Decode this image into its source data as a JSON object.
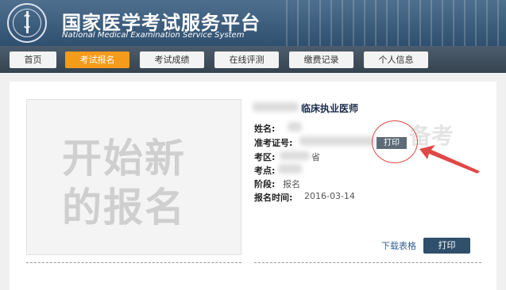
{
  "header": {
    "title_cn": "国家医学考试服务平台",
    "title_en": "National Medical Examination Service System"
  },
  "nav": {
    "items": [
      {
        "label": "首页"
      },
      {
        "label": "考试报名",
        "active": true
      },
      {
        "label": "考试成绩"
      },
      {
        "label": "在线评测"
      },
      {
        "label": "缴费记录"
      },
      {
        "label": "个人信息"
      }
    ]
  },
  "card": {
    "watermark_line1": "开始新",
    "watermark_line2": "的报名",
    "watermark_side": "备考",
    "exam_title": "临床执业医师",
    "fields": {
      "name_label": "姓名:",
      "ticket_label": "准考证号:",
      "district_label": "考区:",
      "district_value": "省",
      "site_label": "考点:",
      "stage_label": "阶段:",
      "stage_value": "报名",
      "time_label": "报名时间:",
      "time_value": "2016-03-14"
    },
    "print_inline_label": "打印",
    "download_label": "下载表格",
    "print_label": "打印"
  },
  "colors": {
    "header_bg": "#3c5c7c",
    "nav_active": "#f49b1a",
    "annotation": "#e04848",
    "print_button": "#2f4f6b"
  }
}
